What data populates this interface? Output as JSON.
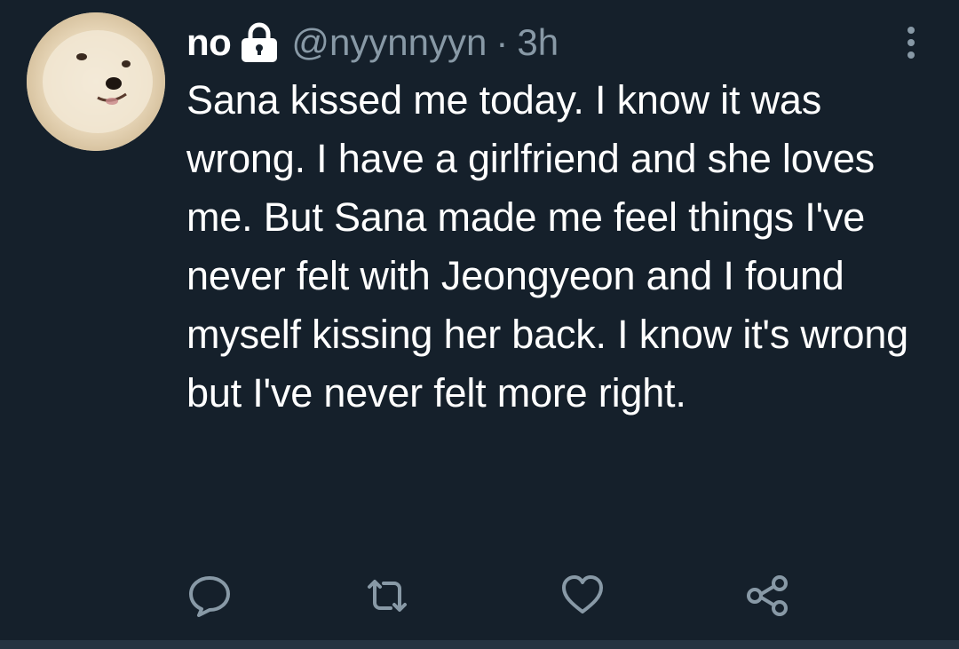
{
  "tweet": {
    "display_name": "no",
    "handle": "@nyynnyyn",
    "separator": "·",
    "time": "3h",
    "text": "Sana kissed me today. I know it was wrong. I have a girlfriend and she loves me. But Sana made me feel things I've never felt with Jeongyeon and I found myself kissing her back. I know it's wrong but I've never felt more right."
  },
  "icons": {
    "avatar": "pomeranian-dog-avatar",
    "protected": "lock-icon",
    "more": "more-vertical-icon",
    "reply": "reply-icon",
    "retweet": "retweet-icon",
    "like": "heart-icon",
    "share": "share-icon"
  },
  "colors": {
    "background": "#15202b",
    "primary_text": "#ffffff",
    "secondary_text": "#8899a6",
    "divider": "#253341"
  }
}
